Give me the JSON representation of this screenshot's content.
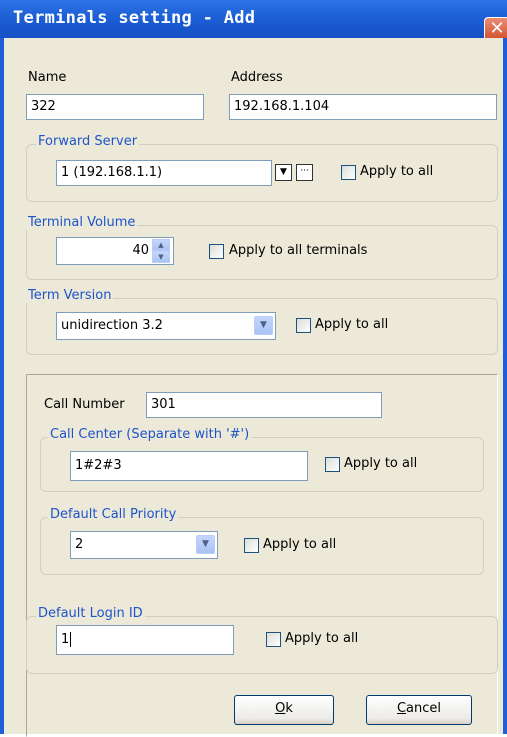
{
  "window": {
    "title": "Terminals setting - Add",
    "close_glyph": "✕"
  },
  "name": {
    "label": "Name",
    "value": "322"
  },
  "address": {
    "label": "Address",
    "value": "192.168.1.104"
  },
  "forward_server": {
    "legend": "Forward Server",
    "value": "1 (192.168.1.1)",
    "apply_label": "Apply to all",
    "browse_glyph": "···"
  },
  "terminal_volume": {
    "legend": "Terminal Volume",
    "value": "40",
    "apply_label": "Apply to all terminals"
  },
  "term_version": {
    "legend": "Term Version",
    "value": "unidirection 3.2",
    "apply_label": "Apply to all"
  },
  "call_number": {
    "label": "Call Number",
    "value": "301"
  },
  "call_center": {
    "legend": "Call Center  (Separate with '#')",
    "value": "1#2#3",
    "apply_label": "Apply to all"
  },
  "default_call_priority": {
    "legend": "Default Call Priority",
    "value": "2",
    "apply_label": "Apply to all"
  },
  "default_login_id": {
    "legend": "Default Login ID",
    "value": "1",
    "apply_label": "Apply to all"
  },
  "buttons": {
    "ok_mnemonic": "O",
    "ok_rest": "k",
    "cancel_mnemonic": "C",
    "cancel_rest": "ancel"
  },
  "colors": {
    "titlebar": "#1c5fd6",
    "legend": "#1d54cb",
    "face": "#ece9d8",
    "field_border": "#7f9db9",
    "close": "#d04a23"
  },
  "icons": {
    "close": "close-icon",
    "dropdown": "chevron-down-icon",
    "spin_up": "arrow-up-icon",
    "spin_down": "arrow-down-icon",
    "browse": "ellipsis-icon",
    "dropdown_small": "triangle-down-icon"
  }
}
